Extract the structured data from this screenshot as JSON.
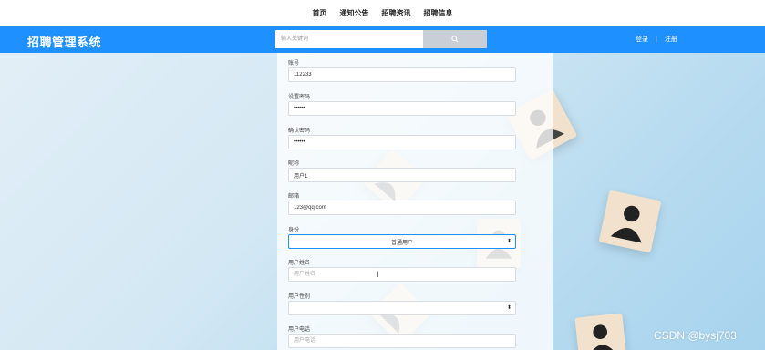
{
  "topnav": {
    "items": [
      {
        "label": "首页"
      },
      {
        "label": "通知公告"
      },
      {
        "label": "招聘资讯"
      },
      {
        "label": "招聘信息"
      }
    ]
  },
  "header": {
    "title": "招聘管理系统",
    "search": {
      "placeholder": "输入关键词",
      "value": ""
    },
    "search_icon": "search-icon",
    "login_label": "登录",
    "divider": "|",
    "register_label": "注册"
  },
  "form": {
    "account": {
      "label": "账号",
      "value": "112233"
    },
    "password": {
      "label": "设置密码",
      "value": "••••••"
    },
    "confirm_password": {
      "label": "确认密码",
      "value": "••••••"
    },
    "nickname": {
      "label": "昵称",
      "value": "用户1"
    },
    "email": {
      "label": "邮箱",
      "value": "123@qq.com"
    },
    "role": {
      "label": "身份",
      "value": "普通用户"
    },
    "real_name": {
      "label": "用户姓名",
      "placeholder": "用户姓名"
    },
    "gender": {
      "label": "用户性别",
      "value": ""
    },
    "phone": {
      "label": "用户电话",
      "placeholder": "用户电话"
    }
  },
  "watermark": "CSDN @bysj703",
  "colors": {
    "header": "#1e90ff",
    "accent": "#1e90ff"
  }
}
